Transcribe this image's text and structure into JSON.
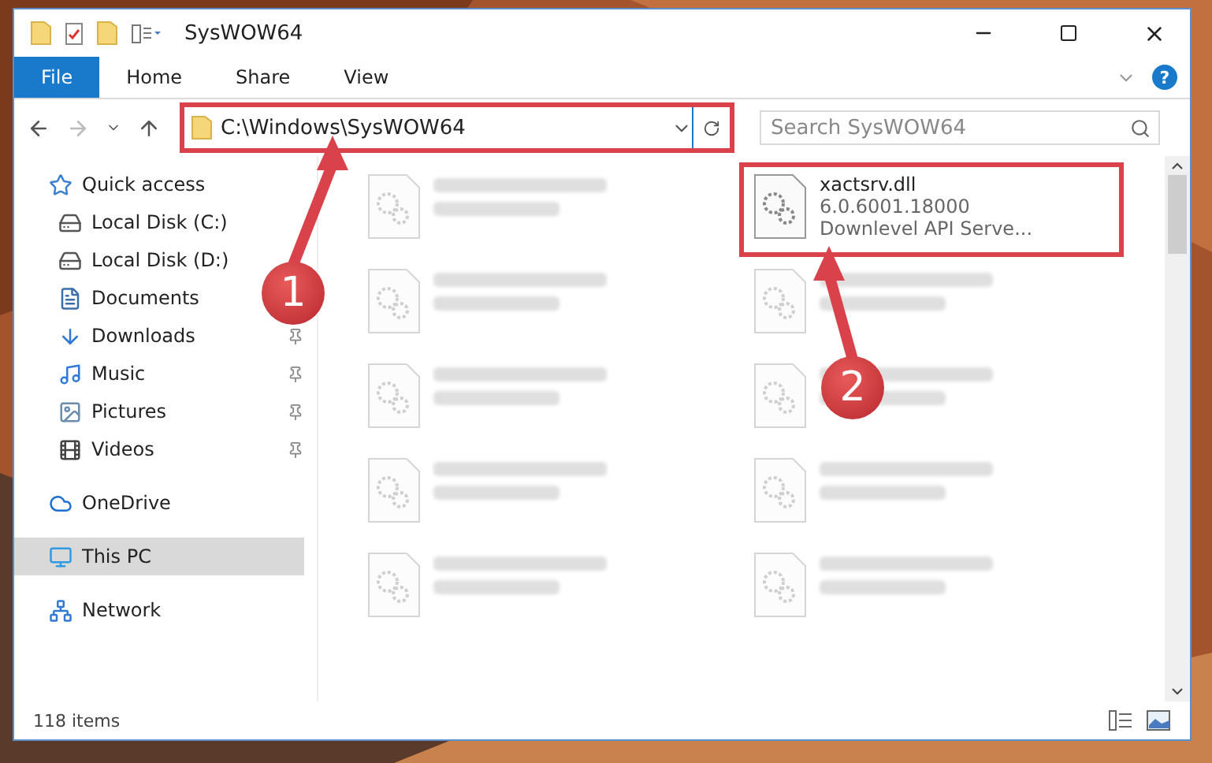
{
  "window": {
    "title": "SysWOW64"
  },
  "ribbon": {
    "tabs": [
      {
        "label": "File",
        "selected": true
      },
      {
        "label": "Home",
        "selected": false
      },
      {
        "label": "Share",
        "selected": false
      },
      {
        "label": "View",
        "selected": false
      }
    ],
    "help": "?"
  },
  "address": {
    "path": "C:\\Windows\\SysWOW64",
    "highlighted": true
  },
  "search": {
    "placeholder": "Search SysWOW64"
  },
  "sidebar": {
    "items": [
      {
        "label": "Quick access",
        "selected": false,
        "children": [
          {
            "label": "Local Disk (C:)",
            "pinned": false
          },
          {
            "label": "Local Disk (D:)",
            "pinned": false
          },
          {
            "label": "Documents",
            "pinned": false
          },
          {
            "label": "Downloads",
            "pinned": true
          },
          {
            "label": "Music",
            "pinned": true
          },
          {
            "label": "Pictures",
            "pinned": true
          },
          {
            "label": "Videos",
            "pinned": true
          }
        ]
      },
      {
        "label": "OneDrive",
        "selected": false
      },
      {
        "label": "This PC",
        "selected": true
      },
      {
        "label": "Network",
        "selected": false
      }
    ]
  },
  "files": [
    {
      "kind": "blurred",
      "highlighted": false
    },
    {
      "kind": "file",
      "name": "xactsrv.dll",
      "lines": [
        "6.0.6001.18000",
        "Downlevel API Serve..."
      ],
      "highlighted": true
    },
    {
      "kind": "blurred",
      "highlighted": false
    },
    {
      "kind": "blurred",
      "highlighted": false
    },
    {
      "kind": "blurred",
      "highlighted": false
    },
    {
      "kind": "blurred",
      "highlighted": false
    },
    {
      "kind": "blurred",
      "highlighted": false
    },
    {
      "kind": "blurred",
      "highlighted": false
    },
    {
      "kind": "blurred",
      "highlighted": false
    },
    {
      "kind": "blurred",
      "highlighted": false
    }
  ],
  "status_bar": {
    "count": "118 items"
  },
  "callouts": [
    {
      "number": "1"
    },
    {
      "number": "2"
    }
  ]
}
